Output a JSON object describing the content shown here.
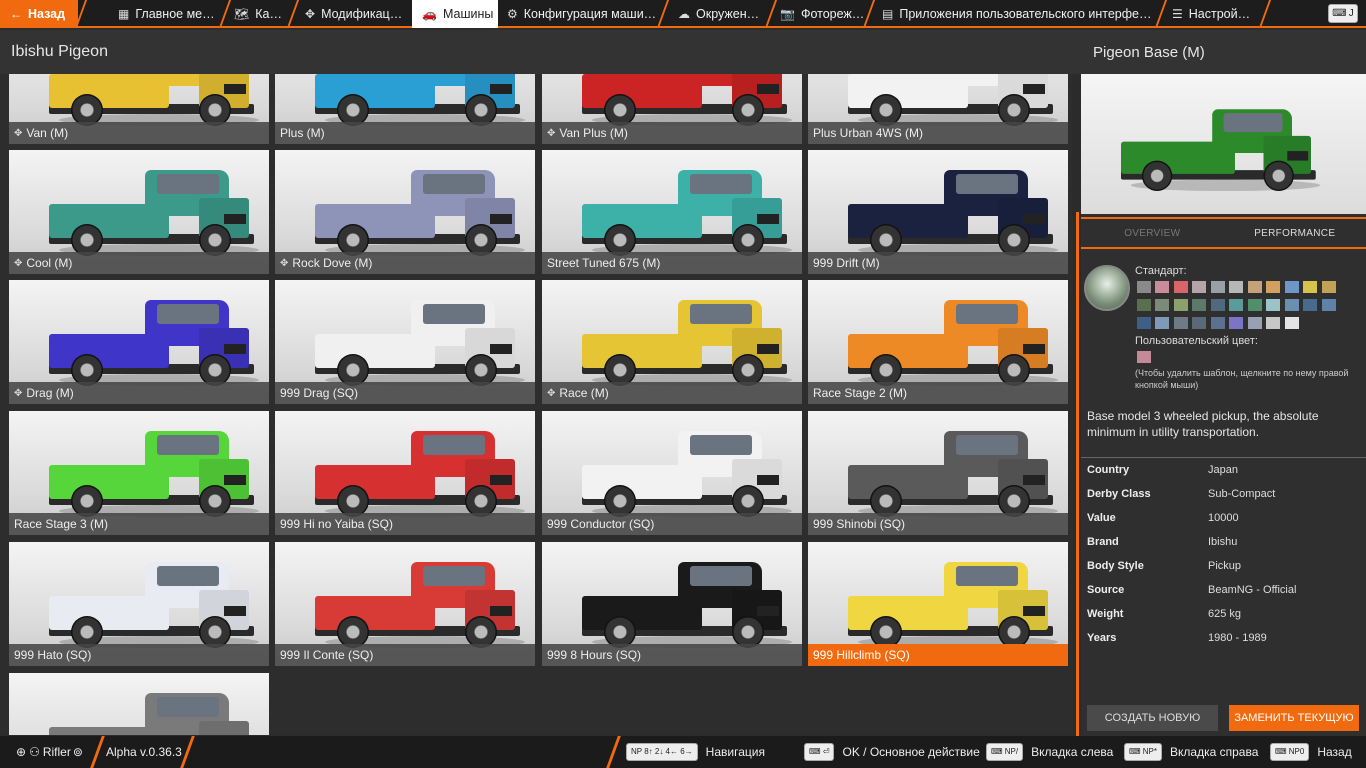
{
  "top_bar": {
    "back": "Назад",
    "tabs": [
      {
        "label": "Главное ме…",
        "icon": "grid-icon"
      },
      {
        "label": "Ка…",
        "icon": "map-icon"
      },
      {
        "label": "Модификац…",
        "icon": "puzzle-icon"
      },
      {
        "label": "Машины",
        "icon": "car-icon",
        "active": true
      },
      {
        "label": "Конфигурация маши…",
        "icon": "engine-icon"
      },
      {
        "label": "Окружен…",
        "icon": "weather-icon"
      },
      {
        "label": "Фотореж…",
        "icon": "camera-icon"
      },
      {
        "label": "Приложения пользовательского интерфе…",
        "icon": "apps-icon"
      },
      {
        "label": "Настрой…",
        "icon": "sliders-icon"
      }
    ],
    "key_hint": "J"
  },
  "left": {
    "title": "Ibishu Pigeon",
    "cards": [
      {
        "label": "Van (M)",
        "mod": true,
        "color": "#e8c132"
      },
      {
        "label": "Plus (M)",
        "mod": false,
        "color": "#2a9fd4"
      },
      {
        "label": "Van Plus (M)",
        "mod": true,
        "color": "#cc2424"
      },
      {
        "label": "Plus Urban 4WS (M)",
        "mod": false,
        "color": "#f2f2f2"
      },
      {
        "label": "Cool (M)",
        "mod": true,
        "color": "#3b9a89"
      },
      {
        "label": "Rock Dove (M)",
        "mod": true,
        "color": "#8e93b8"
      },
      {
        "label": "Street Tuned 675 (M)",
        "mod": false,
        "color": "#3db0a8"
      },
      {
        "label": "999 Drift (M)",
        "mod": false,
        "color": "#1b2240"
      },
      {
        "label": "Drag (M)",
        "mod": true,
        "color": "#3f35c8"
      },
      {
        "label": "999 Drag (SQ)",
        "mod": false,
        "color": "#f0f0f0"
      },
      {
        "label": "Race (M)",
        "mod": true,
        "color": "#e6c534"
      },
      {
        "label": "Race Stage 2 (M)",
        "mod": false,
        "color": "#ee8a26"
      },
      {
        "label": "Race Stage 3 (M)",
        "mod": false,
        "color": "#56d63a"
      },
      {
        "label": "999 Hi no Yaiba (SQ)",
        "mod": false,
        "color": "#d63030"
      },
      {
        "label": "999 Conductor (SQ)",
        "mod": false,
        "color": "#f2f2f2"
      },
      {
        "label": "999 Shinobi (SQ)",
        "mod": false,
        "color": "#5a5a5a"
      },
      {
        "label": "999 Hato (SQ)",
        "mod": false,
        "color": "#e8ecf2"
      },
      {
        "label": "999 Il Conte (SQ)",
        "mod": false,
        "color": "#d83a36"
      },
      {
        "label": "999 8 Hours (SQ)",
        "mod": false,
        "color": "#1a1a1a"
      },
      {
        "label": "999 Hillclimb (SQ)",
        "mod": false,
        "color": "#f0d640",
        "selected": true
      },
      {
        "label": "",
        "mod": false,
        "color": "#7a7a7a"
      }
    ]
  },
  "right": {
    "title": "Pigeon Base (M)",
    "preview_color": "#2d8a2b",
    "tabs": {
      "overview": "OVERVIEW",
      "performance": "PERFORMANCE"
    },
    "paint_standard_label": "Стандарт:",
    "paint_custom_label": "Пользовательский цвет:",
    "paint_hint": "(Чтобы удалить шаблон, щелкните по нему правой кнопкой мыши)",
    "swatches": [
      "#8a8a8a",
      "#c98c9a",
      "#d9656b",
      "#b5a4a8",
      "#9aa0a8",
      "#b7b7b7",
      "#c4a27c",
      "#d3a060",
      "#6e96c9",
      "#d6c24c",
      "#c2a356",
      "#5a6e50",
      "#7b8a7a",
      "#8ba06a",
      "#5c7a6a",
      "#4e6a7c",
      "#5a9c9a",
      "#4f8f6a",
      "#9cc4c8",
      "#6a8fb0",
      "#4a6a8c",
      "#5f82a8",
      "#3e5f86",
      "#7f99b8",
      "#6f7a88",
      "#5b6878",
      "#5a7290",
      "#7c74c4",
      "#9aa0b4",
      "#c8c8c8",
      "#e4e4e4"
    ],
    "custom_swatch": "#c58a9a",
    "description": "Base model 3 wheeled pickup, the absolute minimum in utility transportation.",
    "info": [
      {
        "k": "Country",
        "v": "Japan"
      },
      {
        "k": "Derby Class",
        "v": "Sub-Compact"
      },
      {
        "k": "Value",
        "v": "10000"
      },
      {
        "k": "Brand",
        "v": "Ibishu"
      },
      {
        "k": "Body Style",
        "v": "Pickup"
      },
      {
        "k": "Source",
        "v": "BeamNG - Official"
      },
      {
        "k": "Weight",
        "v": "625 kg"
      },
      {
        "k": "Years",
        "v": "1980 - 1989"
      }
    ],
    "btn_new": "СОЗДАТЬ НОВУЮ",
    "btn_replace": "ЗАМЕНИТЬ ТЕКУЩУЮ"
  },
  "bottom_bar": {
    "user": "Rifler",
    "version": "Alpha v.0.36.3",
    "hints": [
      {
        "keys": "NP 8↑ 2↓ 4← 6→",
        "label": "Навигация"
      },
      {
        "keys": "⏎",
        "label": "OK / Основное действие"
      },
      {
        "keys": "NP/",
        "label": "Вкладка слева"
      },
      {
        "keys": "NP*",
        "label": "Вкладка справа"
      },
      {
        "keys": "NP0",
        "label": "Назад"
      }
    ]
  }
}
